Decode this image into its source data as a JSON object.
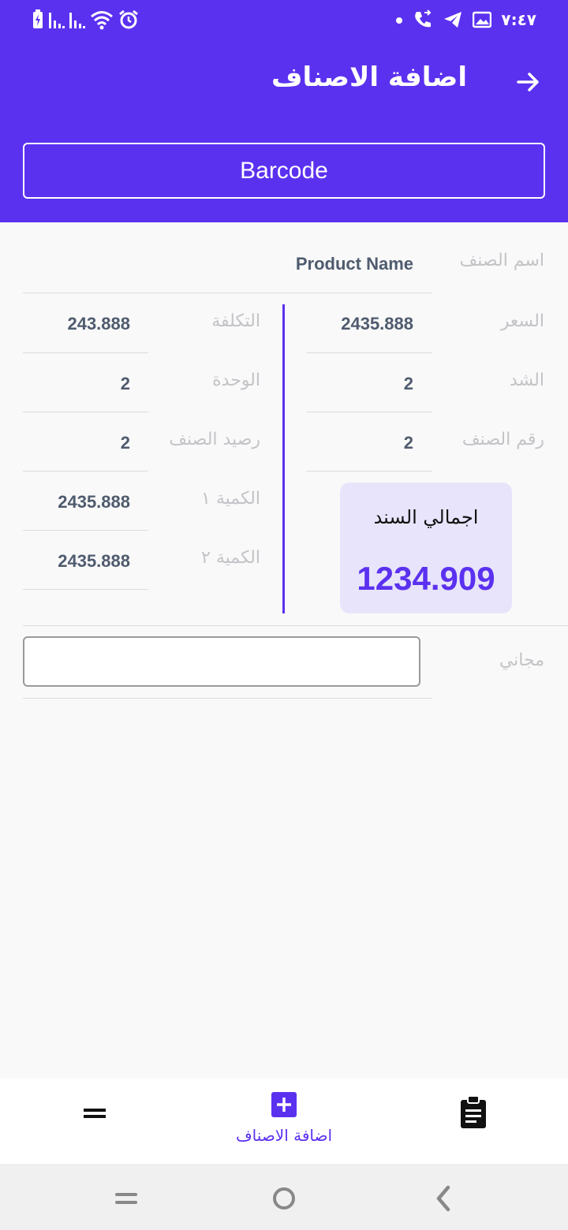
{
  "status_bar": {
    "time": "٧:٤٧",
    "icons_left": [
      "battery-charging-icon",
      "signal-icon",
      "signal-icon",
      "wifi-icon",
      "alarm-icon"
    ],
    "icons_right": [
      "dot-icon",
      "call-forward-icon",
      "telegram-icon",
      "image-icon"
    ]
  },
  "appbar": {
    "title": "اضافة الاصناف",
    "back_icon": "arrow-right-icon"
  },
  "barcode_button": {
    "label": "Barcode"
  },
  "form": {
    "product_name": {
      "label": "اسم الصنف",
      "value": "Product Name"
    },
    "price": {
      "label": "السعر",
      "value": "2435.888"
    },
    "cost": {
      "label": "التكلفة",
      "value": "243.888"
    },
    "pack": {
      "label": "الشد",
      "value": "2"
    },
    "unit": {
      "label": "الوحدة",
      "value": "2"
    },
    "item_number": {
      "label": "رقم الصنف",
      "value": "2"
    },
    "item_balance": {
      "label": "رصيد الصنف",
      "value": "2"
    },
    "quantity1": {
      "label": "الكمية ١",
      "value": "2435.888"
    },
    "quantity2": {
      "label": "الكمية ٢",
      "value": "2435.888"
    },
    "free": {
      "label": "مجاني",
      "value": ""
    }
  },
  "total": {
    "label": "اجمالي السند",
    "value": "1234.909"
  },
  "bottom_nav": {
    "items": [
      {
        "icon": "menu-icon",
        "label": ""
      },
      {
        "icon": "add-box-icon",
        "label": "اضافة الاصناف"
      },
      {
        "icon": "clipboard-icon",
        "label": ""
      }
    ]
  },
  "colors": {
    "primary": "#5b31f0",
    "card_bg": "#e8e4fb",
    "label_gray": "#c3c3c8",
    "value_gray": "#4f5b6e"
  }
}
